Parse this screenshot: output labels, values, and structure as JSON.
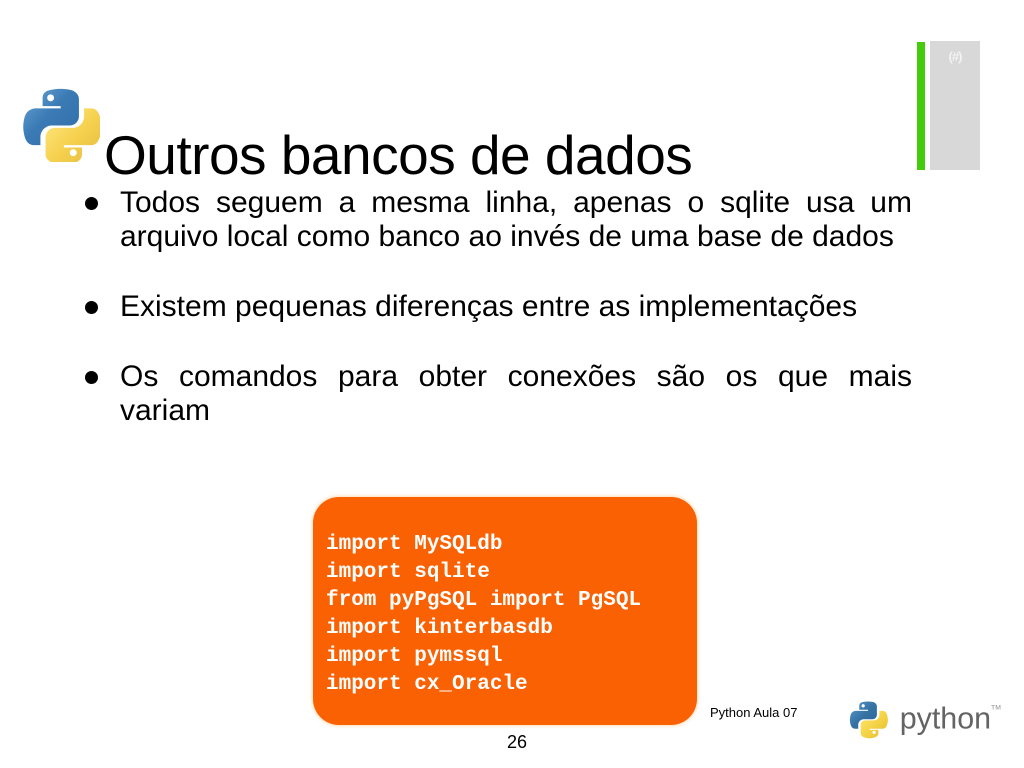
{
  "slide": {
    "title": "Outros bancos de dados",
    "page_number": "26",
    "footer_label": "Python Aula 07",
    "deco_hash": "(#)",
    "colors": {
      "accent_green": "#45cc0c",
      "deco_gray": "#d8d8d8",
      "code_orange": "#f96102",
      "text": "#000000",
      "code_text": "#ffffff"
    },
    "bullets": [
      "Todos seguem a mesma linha, apenas o sqlite usa um arquivo local como banco ao invés de uma base de dados",
      "Existem pequenas diferenças entre as implementações",
      "Os comandos para obter conexões são os que mais variam"
    ],
    "code_block": {
      "lines": [
        "import MySQLdb",
        "import sqlite",
        "from pyPgSQL import PgSQL",
        "import kinterbasdb",
        "import pymssql",
        "import cx_Oracle"
      ],
      "text": "import MySQLdb\nimport sqlite\nfrom pyPgSQL import PgSQL\nimport kinterbasdb\nimport pymssql\nimport cx_Oracle"
    },
    "brand": {
      "wordmark": "python",
      "trademark": "TM"
    }
  }
}
